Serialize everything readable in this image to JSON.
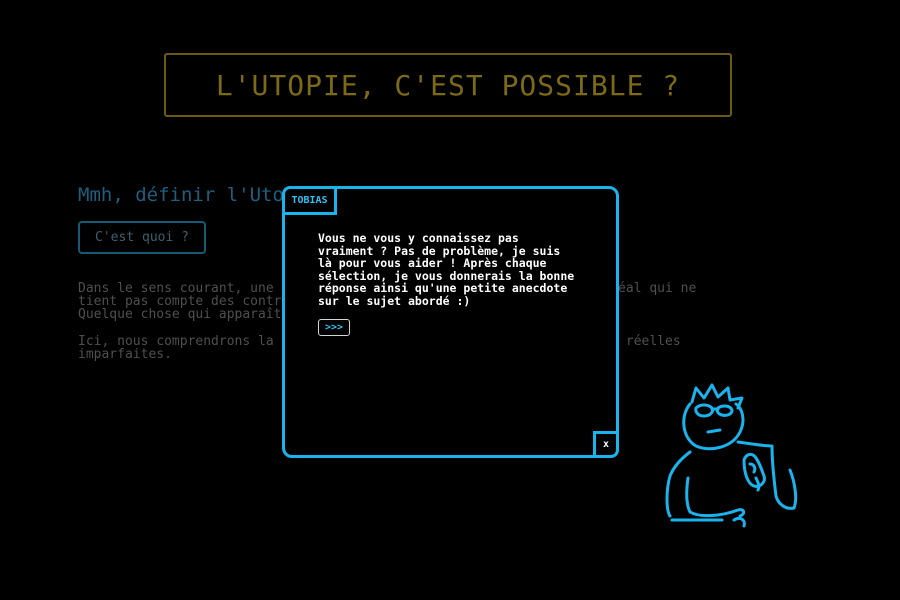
{
  "page": {
    "title": "L'UTOPIE, C'EST POSSIBLE ?",
    "question": "Mmh, définir l'Utopie...",
    "what_button": "C'est quoi ?",
    "paragraph1": "Dans le sens courant, une utopie désigne un projet politique ou un idéal qui ne\ntient pas compte des contraintes de la réalité.\nQuelque chose qui apparaît comme irréalisable en pratique.",
    "paragraph2": "Ici, nous comprendrons la société utopique comme opposée aux sociétés réelles\nimparfaites."
  },
  "dialog": {
    "speaker": "TOBIAS",
    "message": "Vous ne vous y connaissez pas\nvraiment ? Pas de problème, je suis\nlà pour vous aider ! Après chaque\nsélection, je vous donnerais la bonne\nréponse ainsi qu'une petite anecdote\nsur le sujet abordé :)",
    "next_label": ">>>",
    "close_label": "x"
  },
  "colors": {
    "accent": "#19b4ee",
    "title_gold": "#7c6a15",
    "question_blue": "#1d5f7e"
  },
  "icons": {
    "mascot": "tobias-character-icon"
  }
}
